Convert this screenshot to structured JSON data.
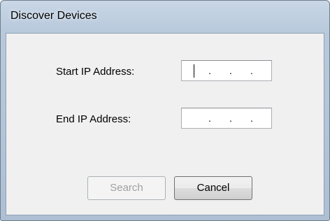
{
  "window": {
    "title": "Discover Devices"
  },
  "form": {
    "start_ip_label": "Start IP Address:",
    "end_ip_label": "End IP Address:",
    "start_ip_value": ". . .",
    "end_ip_value": ". . .",
    "dot": "."
  },
  "buttons": {
    "search_label": "Search",
    "cancel_label": "Cancel"
  }
}
